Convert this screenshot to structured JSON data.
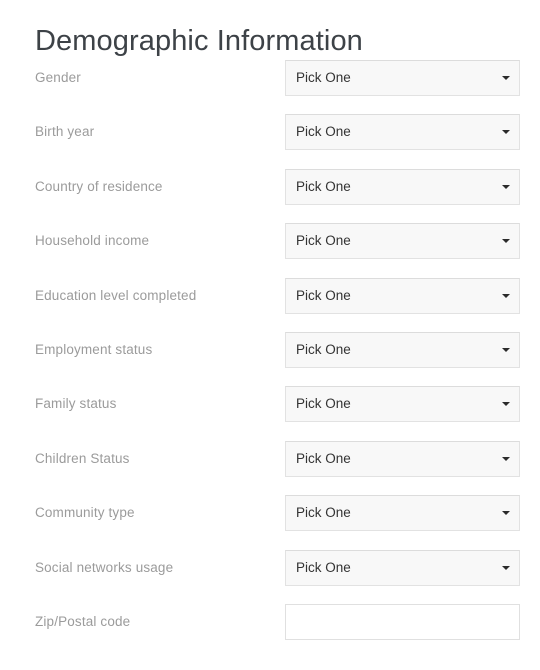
{
  "page": {
    "title": "Demographic Information",
    "background_color": "#ffffff",
    "title_color": "#3d4247",
    "label_color": "#9b9b9b",
    "select_background_color": "#f8f8f8",
    "select_border_color": "#e2e2e2",
    "value_color": "#333333"
  },
  "form": {
    "fields": [
      {
        "label": "Gender",
        "type": "select",
        "value": "Pick One",
        "icon": "chevron-down-icon"
      },
      {
        "label": "Birth year",
        "type": "select",
        "value": "Pick One",
        "icon": "chevron-down-icon"
      },
      {
        "label": "Country of residence",
        "type": "select",
        "value": "Pick One",
        "icon": "chevron-down-icon"
      },
      {
        "label": "Household income",
        "type": "select",
        "value": "Pick One",
        "icon": "chevron-down-icon"
      },
      {
        "label": "Education level completed",
        "type": "select",
        "value": "Pick One",
        "icon": "chevron-down-icon"
      },
      {
        "label": "Employment status",
        "type": "select",
        "value": "Pick One",
        "icon": "chevron-down-icon"
      },
      {
        "label": "Family status",
        "type": "select",
        "value": "Pick One",
        "icon": "chevron-down-icon"
      },
      {
        "label": "Children Status",
        "type": "select",
        "value": "Pick One",
        "icon": "chevron-down-icon"
      },
      {
        "label": "Community type",
        "type": "select",
        "value": "Pick One",
        "icon": "chevron-down-icon"
      },
      {
        "label": "Social networks usage",
        "type": "select",
        "value": "Pick One",
        "icon": "chevron-down-icon"
      },
      {
        "label": "Zip/Postal code",
        "type": "text",
        "value": "",
        "placeholder": ""
      }
    ]
  }
}
